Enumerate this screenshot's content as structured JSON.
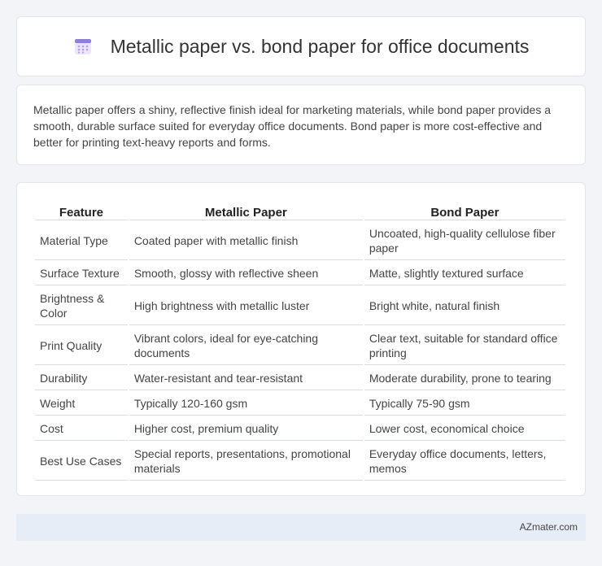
{
  "header": {
    "title": "Metallic paper vs. bond paper for office documents",
    "icon": "calendar-grid-icon"
  },
  "summary": {
    "text": "Metallic paper offers a shiny, reflective finish ideal for marketing materials, while bond paper provides a smooth, durable surface suited for everyday office documents. Bond paper is more cost-effective and better for printing text-heavy reports and forms."
  },
  "table": {
    "headers": [
      "Feature",
      "Metallic Paper",
      "Bond Paper"
    ],
    "rows": [
      {
        "feature": "Material Type",
        "metallic": "Coated paper with metallic finish",
        "bond": "Uncoated, high-quality cellulose fiber paper"
      },
      {
        "feature": "Surface Texture",
        "metallic": "Smooth, glossy with reflective sheen",
        "bond": "Matte, slightly textured surface"
      },
      {
        "feature": "Brightness & Color",
        "metallic": "High brightness with metallic luster",
        "bond": "Bright white, natural finish"
      },
      {
        "feature": "Print Quality",
        "metallic": "Vibrant colors, ideal for eye-catching documents",
        "bond": "Clear text, suitable for standard office printing"
      },
      {
        "feature": "Durability",
        "metallic": "Water-resistant and tear-resistant",
        "bond": "Moderate durability, prone to tearing"
      },
      {
        "feature": "Weight",
        "metallic": "Typically 120-160 gsm",
        "bond": "Typically 75-90 gsm"
      },
      {
        "feature": "Cost",
        "metallic": "Higher cost, premium quality",
        "bond": "Lower cost, economical choice"
      },
      {
        "feature": "Best Use Cases",
        "metallic": "Special reports, presentations, promotional materials",
        "bond": "Everyday office documents, letters, memos"
      }
    ]
  },
  "footer": {
    "site": "AZmater.com"
  }
}
